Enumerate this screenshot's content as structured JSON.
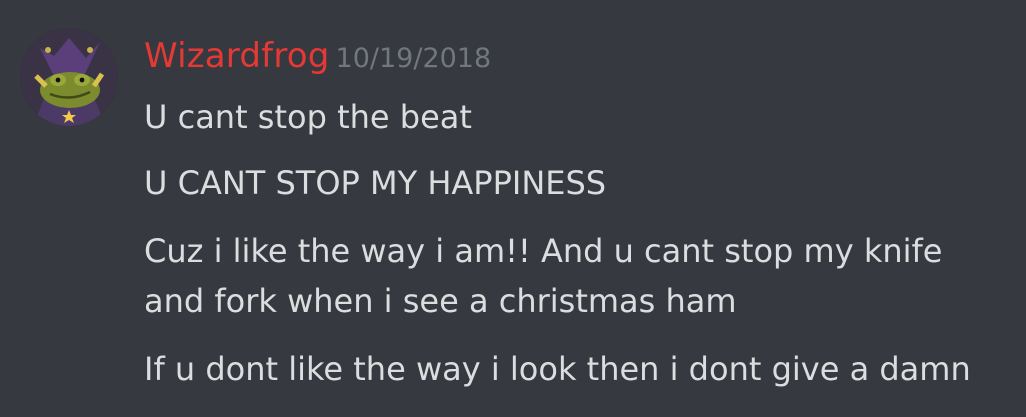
{
  "message": {
    "author": "Wizardfrog",
    "timestamp": "10/19/2018",
    "lines": [
      "U cant stop the beat",
      "U CANT STOP MY HAPPINESS",
      "Cuz i like the way i am!! And u cant stop my knife",
      "and fork when i see a christmas ham",
      "If u dont like the way i look then i dont give a damn"
    ]
  },
  "colors": {
    "background": "#36393f",
    "username": "#e53935",
    "timestamp": "#72767d",
    "text": "#dcddde"
  },
  "icons": {
    "avatar": "frog-wizard-avatar"
  }
}
